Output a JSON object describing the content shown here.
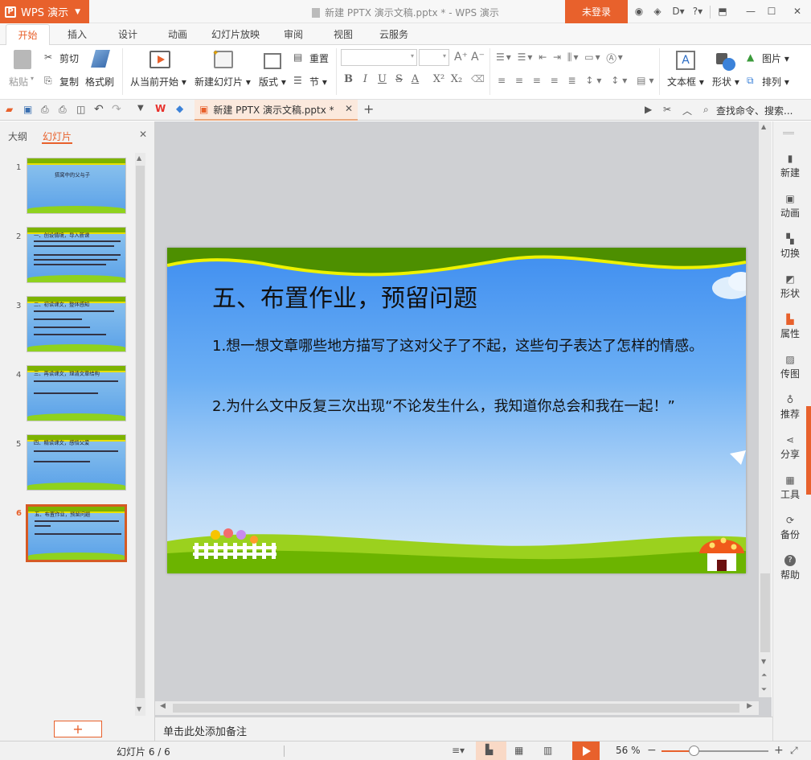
{
  "app": {
    "name": "WPS 演示",
    "window_title": "新建 PPTX 演示文稿.pptx * - WPS 演示",
    "login_label": "未登录",
    "help_label": "?"
  },
  "tabs": [
    {
      "label": "开始",
      "active": true
    },
    {
      "label": "插入"
    },
    {
      "label": "设计"
    },
    {
      "label": "动画"
    },
    {
      "label": "幻灯片放映"
    },
    {
      "label": "审阅"
    },
    {
      "label": "视图"
    },
    {
      "label": "云服务"
    }
  ],
  "ribbon": {
    "paste": "粘贴",
    "cut": "剪切",
    "copy": "复制",
    "format_painter": "格式刷",
    "from_current": "从当前开始",
    "new_slide": "新建幻灯片",
    "layout": "版式",
    "reset": "重置",
    "section": "节",
    "text_box": "文本框",
    "shape": "形状",
    "picture": "图片",
    "arrange": "排列",
    "fmt_bold": "B",
    "fmt_italic": "I",
    "fmt_underline": "U",
    "fmt_strike": "S",
    "fmt_color": "A",
    "fmt_sup": "X²",
    "fmt_sub": "X₂"
  },
  "document_tab": {
    "label": "新建 PPTX 演示文稿.pptx *"
  },
  "search_label": "查找命令、搜索...",
  "left_panel": {
    "tab_outline": "大纲",
    "tab_slides": "幻灯片",
    "add_label": "+"
  },
  "thumbnails": [
    {
      "num": "1",
      "title": "搭窝中的父与子"
    },
    {
      "num": "2",
      "title": "一、创设情境，导入新课"
    },
    {
      "num": "3",
      "title": "二、初读课文，整体感知"
    },
    {
      "num": "4",
      "title": "三、再读课文，理清文章结构"
    },
    {
      "num": "5",
      "title": "四、精读课文，感悟父爱"
    },
    {
      "num": "6",
      "title": "五、布置作业，预留问题",
      "selected": true
    }
  ],
  "slide": {
    "title": "五、布置作业，预留问题",
    "para1": "1.想一想文章哪些地方描写了这对父子了不起，这些句子表达了怎样的情感。",
    "para2": "2.为什么文中反复三次出现“不论发生什么，我知道你总会和我在一起！”"
  },
  "notes_placeholder": "单击此处添加备注",
  "right_bar": [
    {
      "label": "新建",
      "icon": "new-icon"
    },
    {
      "label": "动画",
      "icon": "animation-icon"
    },
    {
      "label": "切换",
      "icon": "transition-icon"
    },
    {
      "label": "形状",
      "icon": "shape-icon"
    },
    {
      "label": "属性",
      "icon": "property-icon"
    },
    {
      "label": "传图",
      "icon": "upload-image-icon"
    },
    {
      "label": "推荐",
      "icon": "recommend-icon"
    },
    {
      "label": "分享",
      "icon": "share-icon"
    },
    {
      "label": "工具",
      "icon": "tools-icon"
    },
    {
      "label": "备份",
      "icon": "backup-icon"
    },
    {
      "label": "帮助",
      "icon": "help-icon"
    }
  ],
  "status": {
    "slide_counter": "幻灯片 6 / 6",
    "zoom": "56 %",
    "zoom_fraction": 0.3
  },
  "colors": {
    "accent": "#e8612c",
    "slide_sky": "#5aa1e8",
    "grass": "#8fd21e"
  }
}
